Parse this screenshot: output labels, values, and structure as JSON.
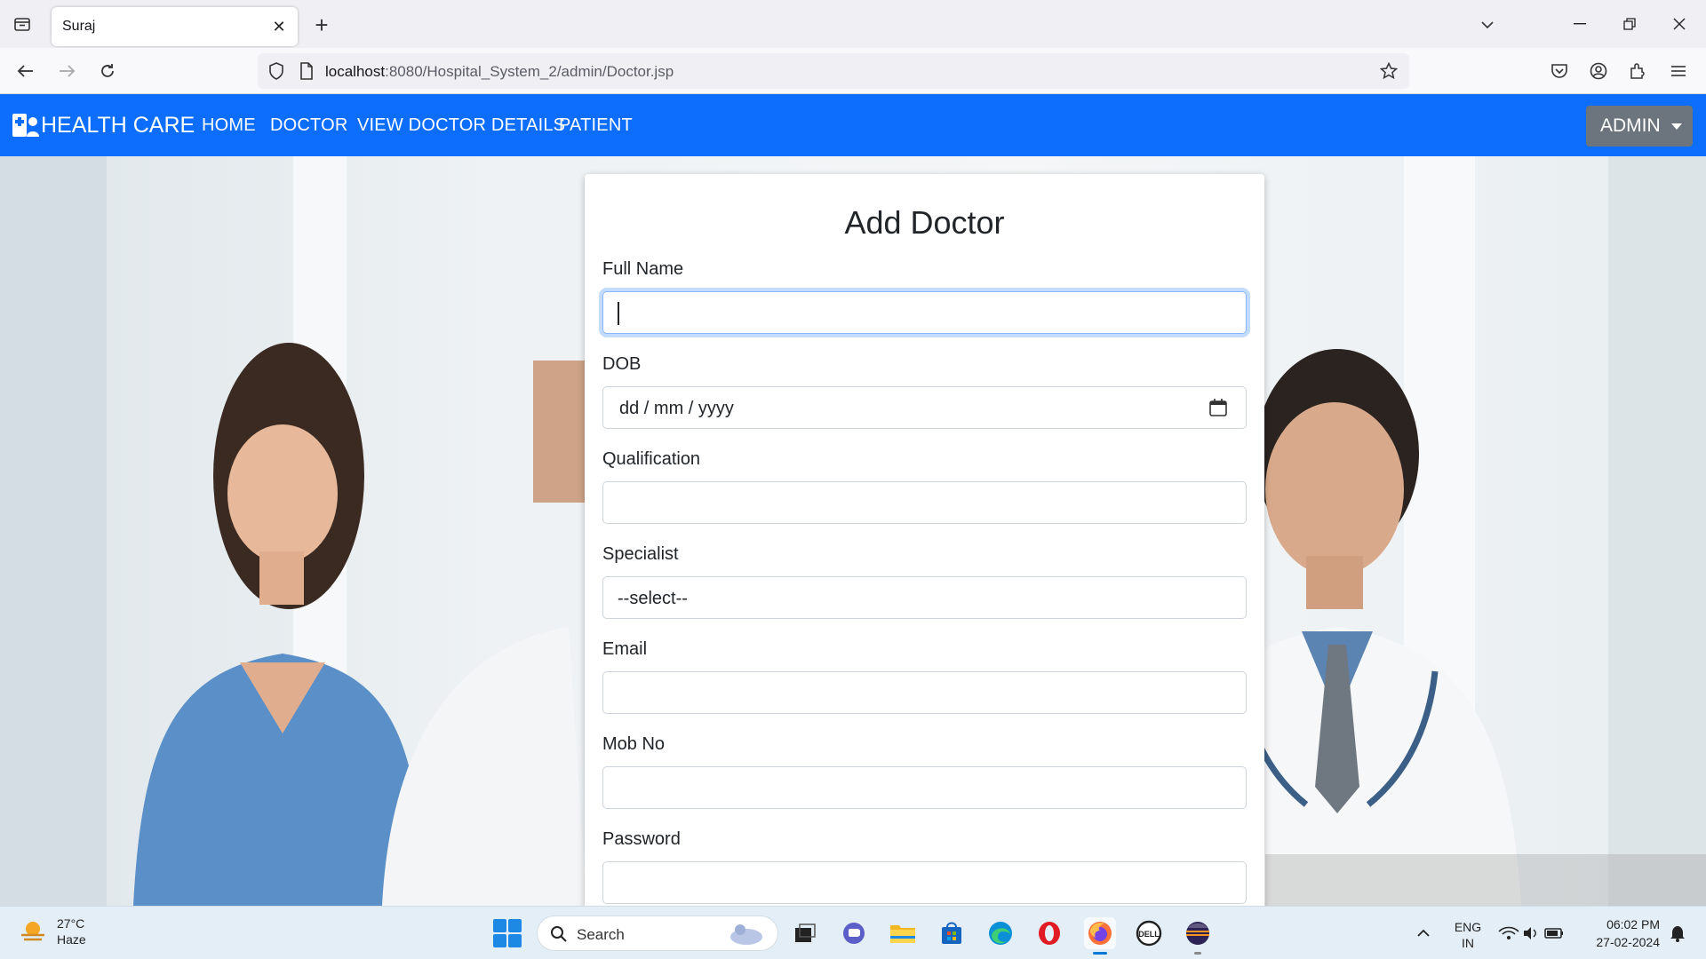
{
  "browser": {
    "tab_title": "Suraj",
    "url_host": "localhost",
    "url_rest": ":8080/Hospital_System_2/admin/Doctor.jsp"
  },
  "app": {
    "brand": "HEALTH CARE",
    "nav": [
      "HOME",
      "DOCTOR",
      "VIEW DOCTOR DETAILS",
      "PATIENT"
    ],
    "admin_label": "ADMIN",
    "accent_color": "#0d6efd"
  },
  "form": {
    "title": "Add Doctor",
    "labels": {
      "full_name": "Full Name",
      "dob": "DOB",
      "qualification": "Qualification",
      "specialist": "Specialist",
      "email": "Email",
      "mob": "Mob No",
      "password": "Password"
    },
    "values": {
      "full_name": "",
      "dob_placeholder": "dd / mm / yyyy",
      "qualification": "",
      "specialist_selected": "--select--",
      "email": "",
      "mob": "",
      "password": ""
    }
  },
  "taskbar": {
    "temperature": "27°C",
    "weather": "Haze",
    "search_label": "Search",
    "lang_top": "ENG",
    "lang_bottom": "IN",
    "time": "06:02 PM",
    "date": "27-02-2024"
  }
}
